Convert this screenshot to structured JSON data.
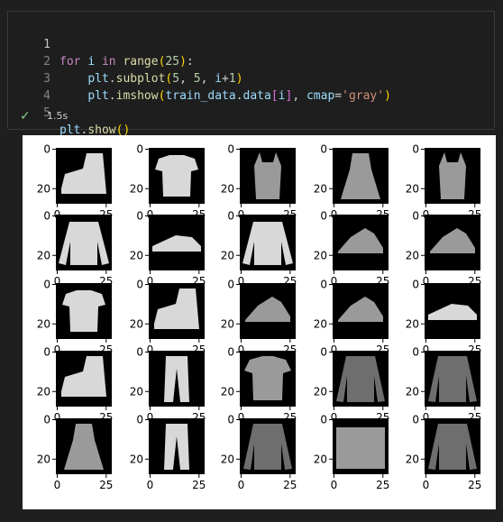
{
  "cell": {
    "code_lines": [
      {
        "num": "1"
      },
      {
        "num": "2"
      },
      {
        "num": "3"
      },
      {
        "num": "4"
      },
      {
        "num": "5"
      }
    ],
    "status": {
      "icon": "check-icon",
      "duration": "1.5s"
    }
  },
  "figure": {
    "tick_labels": {
      "y_zero": "0",
      "y_twenty": "20",
      "x_zero": "0",
      "x_twentyfive": "25"
    },
    "items": [
      "ankle boot",
      "t-shirt",
      "tank top",
      "dress",
      "tank top",
      "pullover",
      "sneaker",
      "pullover",
      "sandal",
      "sandal",
      "t-shirt",
      "ankle boot",
      "sandal",
      "sandal",
      "sneaker",
      "ankle boot",
      "trouser",
      "shirt",
      "coat",
      "coat",
      "dress",
      "trouser",
      "coat",
      "bag",
      "coat"
    ]
  },
  "colors": {
    "background": "#1f1f1f",
    "editor_bg": "#1e1e1e",
    "figure_bg": "#ffffff",
    "check": "#89d185"
  }
}
